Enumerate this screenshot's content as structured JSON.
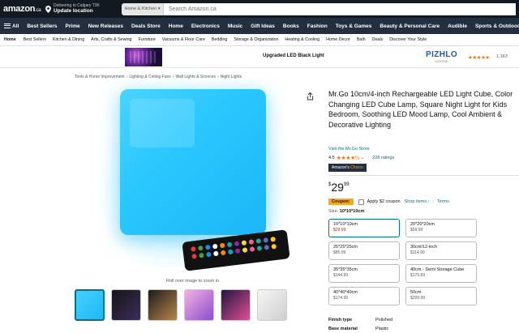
{
  "header": {
    "logo_text": "amazon",
    "logo_suffix": ".ca",
    "deliver_line1": "Delivering to Calgary T3K",
    "deliver_line2": "Update location",
    "search_category": "Home & Kitchen",
    "search_placeholder": "Search Amazon.ca"
  },
  "nav": {
    "all_label": "All",
    "items": [
      "Best Sellers",
      "Prime",
      "New Releases",
      "Deals Store",
      "Home",
      "Electronics",
      "Music",
      "Gift Ideas",
      "Books",
      "Fashion",
      "Toys & Games",
      "Beauty & Personal Care",
      "Audible",
      "Sports & Outdoors"
    ]
  },
  "subnav": {
    "home": "Home",
    "items": [
      "Best Sellers",
      "Kitchen & Dining",
      "Arts, Crafts & Sewing",
      "Furniture",
      "Vacuums & Floor Care",
      "Bedding",
      "Storage & Organization",
      "Heating & Cooling",
      "Home Decor",
      "Bath",
      "Deals",
      "Discover Your Style"
    ]
  },
  "banner": {
    "text": "Upgraded LED Black Light",
    "brand": "PIZHLO",
    "brand_sub": "LIGHTING",
    "stars": "★★★★★",
    "rating_count": "1,163"
  },
  "breadcrumb": [
    "Tools & Home Improvement",
    "Lighting & Ceiling Fans",
    "Wall Lights & Sconces",
    "Night Lights"
  ],
  "gallery": {
    "rollover_text": "Roll over image to zoom in"
  },
  "product": {
    "title": "Mr.Go 10cm/4-inch Rechargeable LED Light Cube, Color Changing LED Cube Lamp, Square Night Light for Kids Bedroom, Soothing LED Mood Lamp, Cool Ambient & Decorative Lighting",
    "store_link": "Visit the Mr.Go Store",
    "rating": "4.5",
    "stars": "★★★★½",
    "rating_count": "228 ratings",
    "badge_prefix": "Amazon's",
    "badge_suffix": "Choice",
    "price_symbol": "$",
    "price_whole": "29",
    "price_fraction": "99",
    "coupon_label": "Coupon:",
    "coupon_text": "Apply $2 coupon",
    "shop_items": "Shop items ›",
    "terms": "Terms",
    "size_label": "Size:",
    "size_selected": "10*10*10cm",
    "sizes": [
      {
        "name": "10*10*10cm",
        "price": "$29.99"
      },
      {
        "name": "20*20*20cm",
        "price": "$59.99"
      },
      {
        "name": "25*25*25cm",
        "price": "$85.99"
      },
      {
        "name": "30cm/12-inch",
        "price": "$114.99"
      },
      {
        "name": "35*35*35cm",
        "price": "$144.99"
      },
      {
        "name": "40cm - Semi Storage Cube",
        "price": "$175.99"
      },
      {
        "name": "40*40*40cm",
        "price": "$174.99"
      },
      {
        "name": "50cm",
        "price": "$299.99"
      }
    ],
    "specs": [
      {
        "key": "Finish type",
        "value": "Polished"
      },
      {
        "key": "Base material",
        "value": "Plastic"
      }
    ]
  },
  "colors": {
    "header_bg": "#131921",
    "nav_bg": "#232f3e",
    "link": "#007185",
    "star": "#de7921",
    "price_red": "#b12704",
    "cube": "#2ac7ff"
  }
}
